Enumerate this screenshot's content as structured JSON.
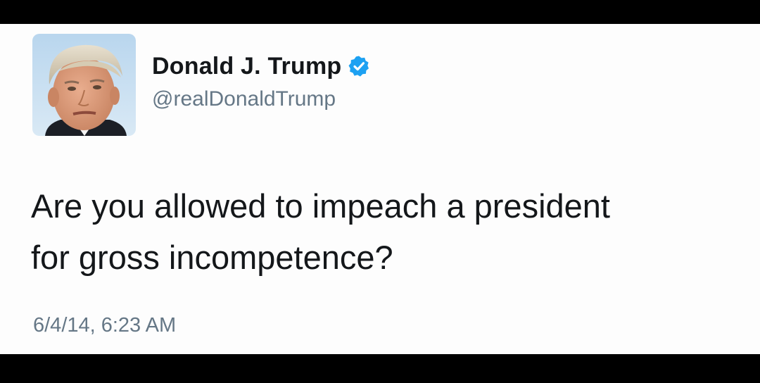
{
  "tweet": {
    "author": {
      "display_name": "Donald J. Trump",
      "handle": "@realDonaldTrump",
      "verified": true,
      "verified_icon": "verified-badge-icon",
      "avatar_icon": "profile-photo"
    },
    "text": "Are you allowed to impeach a president\nfor gross incompetence?",
    "timestamp": "6/4/14, 6:23 AM"
  },
  "colors": {
    "text_primary": "#14171a",
    "text_secondary": "#657786",
    "verified_blue": "#1da1f2",
    "card_background": "#fdfdfd",
    "frame": "#000000"
  }
}
